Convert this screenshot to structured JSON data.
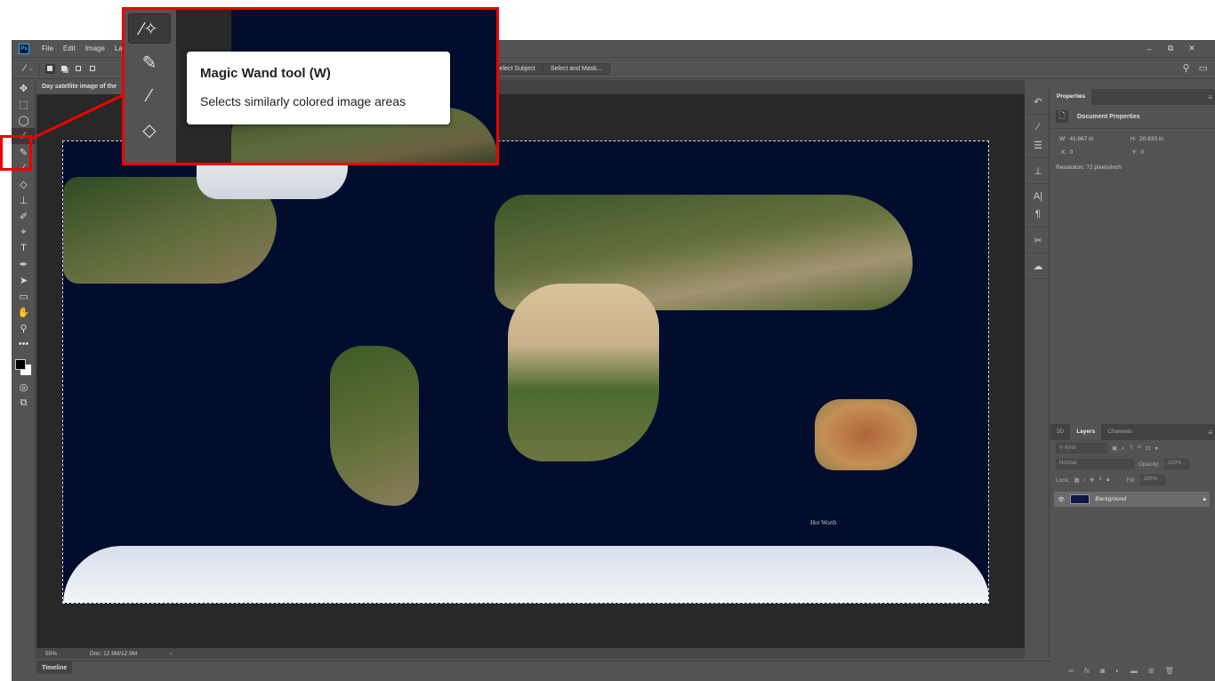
{
  "app": {
    "logo": "Ps",
    "menu": [
      "File",
      "Edit",
      "Image",
      "Layer"
    ],
    "window_controls": {
      "minimize": "–",
      "restore": "⧉",
      "close": "✕"
    }
  },
  "options_bar": {
    "tool_icon": "magic-wand-icon",
    "select_subject": "Select Subject",
    "select_and_mask": "Select and Mask..."
  },
  "document": {
    "tab_title": "Day satellite image of the",
    "zoom": "50%",
    "doc_size": "Doc: 12.9M/12.9M",
    "status_arrow": "›",
    "canvas_label": "Hot Worth"
  },
  "tools": [
    {
      "name": "move",
      "glyph": "✥"
    },
    {
      "name": "marquee",
      "glyph": "⬚"
    },
    {
      "name": "lasso",
      "glyph": "◯"
    },
    {
      "name": "magic-wand",
      "glyph": "⁄",
      "active": true
    },
    {
      "name": "eyedropper",
      "glyph": "✎"
    },
    {
      "name": "brush",
      "glyph": "⁄"
    },
    {
      "name": "paint-bucket",
      "glyph": "◇"
    },
    {
      "name": "clone-stamp",
      "glyph": "⊥"
    },
    {
      "name": "eraser",
      "glyph": "✐"
    },
    {
      "name": "burn",
      "glyph": "⌖"
    },
    {
      "name": "type",
      "glyph": "T"
    },
    {
      "name": "pen",
      "glyph": "✒"
    },
    {
      "name": "path-selection",
      "glyph": "➤"
    },
    {
      "name": "rectangle",
      "glyph": "▭"
    },
    {
      "name": "hand",
      "glyph": "✋"
    },
    {
      "name": "zoom",
      "glyph": "⚲"
    },
    {
      "name": "more",
      "glyph": "•••"
    }
  ],
  "callout": {
    "tooltip_title": "Magic Wand tool (W)",
    "tooltip_desc": "Selects similarly colored image areas"
  },
  "properties": {
    "tab": "Properties",
    "section": "Document Properties",
    "w_label": "W:",
    "w_value": "41.667 in",
    "h_label": "H:",
    "h_value": "20.833 in",
    "x_label": "X:",
    "x_value": "0",
    "y_label": "Y:",
    "y_value": "0",
    "resolution": "Resolution: 72 pixels/inch"
  },
  "layers_panel": {
    "tabs": [
      "3D",
      "Layers",
      "Channels"
    ],
    "active_tab": "Layers",
    "filter_placeholder": "Kind",
    "blend_mode": "Normal",
    "opacity_label": "Opacity:",
    "opacity_value": "100%",
    "lock_label": "Lock:",
    "fill_label": "Fill:",
    "fill_value": "100%",
    "layers": [
      {
        "name": "Background",
        "visible": true,
        "locked": true
      }
    ]
  },
  "timeline": {
    "label": "Timeline"
  },
  "colors": {
    "accent_red": "#ee0000",
    "ps_blue": "#31a8ff",
    "canvas_ocean": "#020d2e"
  }
}
